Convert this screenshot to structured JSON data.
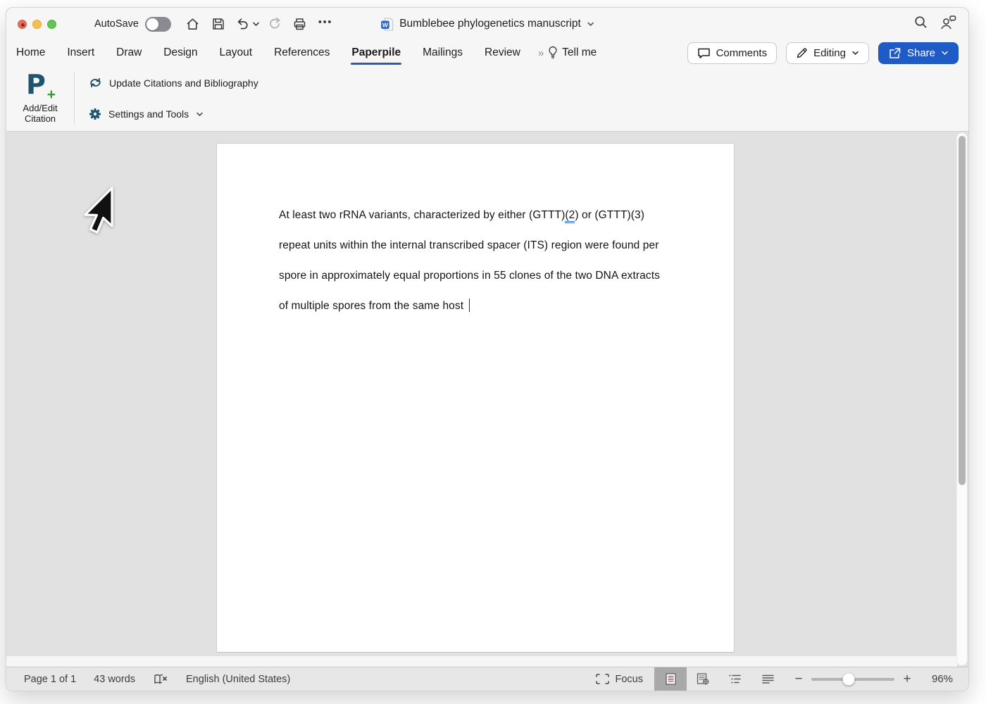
{
  "colors": {
    "accent_blue": "#1e5bc6",
    "tab_underline": "#2a5db0",
    "paperpile_teal": "#20546e",
    "paperpile_green": "#2ea12b",
    "grammar_mark_blue": "#2f6fde",
    "statusbar_selected": "#a9a9aa"
  },
  "titlebar": {
    "autosave_label": "AutoSave",
    "autosave_state": "off",
    "document_title": "Bumblebee phylogenetics manuscript",
    "ellipsis_glyph": "•••"
  },
  "tabs": [
    {
      "label": "Home",
      "active": false
    },
    {
      "label": "Insert",
      "active": false
    },
    {
      "label": "Draw",
      "active": false
    },
    {
      "label": "Design",
      "active": false
    },
    {
      "label": "Layout",
      "active": false
    },
    {
      "label": "References",
      "active": false
    },
    {
      "label": "Paperpile",
      "active": true
    },
    {
      "label": "Mailings",
      "active": false
    },
    {
      "label": "Review",
      "active": false
    }
  ],
  "tab_overflow_glyph": "»",
  "tellme_label": "Tell me",
  "top_actions": {
    "comments_label": "Comments",
    "editing_label": "Editing",
    "share_label": "Share"
  },
  "ribbon": {
    "logo_letter": "P",
    "logo_plus": "+",
    "add_edit_citation_line1": "Add/Edit",
    "add_edit_citation_line2": "Citation",
    "update_citations_label": "Update Citations and Bibliography",
    "settings_tools_label": "Settings and Tools"
  },
  "document": {
    "paragraph": {
      "line1_pre": "At least two rRNA variants, characterized by either (GTTT)",
      "line1_marked": "(2",
      "line1_post": ") or (GTTT)(3)",
      "line2": "repeat units within the internal transcribed spacer (ITS) region were found per",
      "line3": "spore in approximately equal proportions in 55 clones of the two DNA extracts",
      "line4": "of multiple spores from the same host "
    }
  },
  "status_bar": {
    "page_indicator": "Page 1 of 1",
    "word_count": "43 words",
    "language": "English (United States)",
    "focus_label": "Focus",
    "zoom_level": "96%"
  }
}
